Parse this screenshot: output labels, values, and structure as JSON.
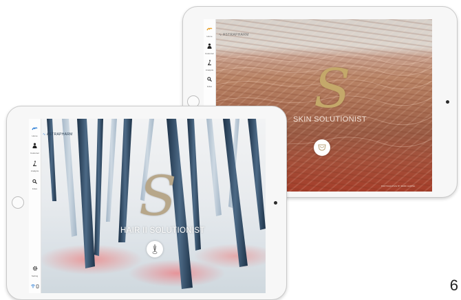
{
  "back_tablet": {
    "brand": "ASTRAPHARM",
    "title_letter": "S",
    "tagline": "SKIN SOLUTIONIST",
    "sidebar": [
      {
        "label": "Home",
        "icon": "logo-icon"
      },
      {
        "label": "Customer",
        "icon": "user-icon"
      },
      {
        "label": "Analysis",
        "icon": "microscope-icon"
      },
      {
        "label": "Index",
        "icon": "search-icon"
      }
    ],
    "credit": "PHOTOGRAPHIE BY MARK HAPPEL",
    "colors": {
      "accent": "#e8a02a",
      "logo": "#c4a86a",
      "skin": "#a9563e"
    }
  },
  "front_tablet": {
    "brand": "ASTRAPHARM",
    "title_letter": "S",
    "tagline": "HAIR II SOLUTIONIST",
    "sidebar": [
      {
        "label": "Home",
        "icon": "logo-icon"
      },
      {
        "label": "Customer",
        "icon": "user-icon"
      },
      {
        "label": "Analysis",
        "icon": "microscope-icon"
      },
      {
        "label": "Index",
        "icon": "search-icon"
      }
    ],
    "sidebar_bottom": [
      {
        "label": "Setting",
        "icon": "gear-icon"
      },
      {
        "label": "",
        "icon": "wifi-icon"
      }
    ],
    "colors": {
      "accent": "#2e7fd6",
      "hair": "#2f4a63",
      "glow": "#ec8c8c"
    }
  },
  "page_number": "6"
}
